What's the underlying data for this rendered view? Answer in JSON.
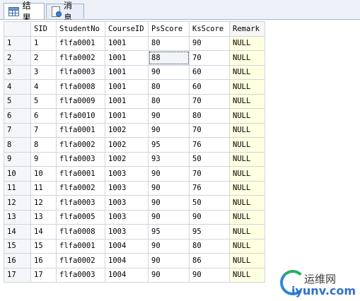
{
  "tabs": [
    {
      "label": "结果",
      "icon": "grid-icon",
      "active": true
    },
    {
      "label": "消息",
      "icon": "message-icon",
      "active": false
    }
  ],
  "columns": [
    "",
    "SID",
    "StudentNo",
    "CourseID",
    "PsScore",
    "KsScore",
    "Remark"
  ],
  "rows": [
    [
      "1",
      "1",
      "flfa0001",
      "1001",
      "80",
      "90",
      "NULL"
    ],
    [
      "2",
      "2",
      "flfa0002",
      "1001",
      "88",
      "70",
      "NULL"
    ],
    [
      "3",
      "3",
      "flfa0003",
      "1001",
      "90",
      "60",
      "NULL"
    ],
    [
      "4",
      "4",
      "flfa0008",
      "1001",
      "80",
      "60",
      "NULL"
    ],
    [
      "5",
      "5",
      "flfa0009",
      "1001",
      "80",
      "70",
      "NULL"
    ],
    [
      "6",
      "6",
      "flfa0010",
      "1001",
      "90",
      "80",
      "NULL"
    ],
    [
      "7",
      "7",
      "flfa0001",
      "1002",
      "90",
      "70",
      "NULL"
    ],
    [
      "8",
      "8",
      "flfa0002",
      "1002",
      "95",
      "76",
      "NULL"
    ],
    [
      "9",
      "9",
      "flfa0003",
      "1002",
      "93",
      "50",
      "NULL"
    ],
    [
      "10",
      "10",
      "flfa0001",
      "1003",
      "90",
      "70",
      "NULL"
    ],
    [
      "11",
      "11",
      "flfa0002",
      "1003",
      "90",
      "76",
      "NULL"
    ],
    [
      "12",
      "12",
      "flfa0003",
      "1003",
      "90",
      "50",
      "NULL"
    ],
    [
      "13",
      "13",
      "flfa0005",
      "1003",
      "90",
      "90",
      "NULL"
    ],
    [
      "14",
      "14",
      "flfa0008",
      "1003",
      "95",
      "95",
      "NULL"
    ],
    [
      "15",
      "15",
      "flfa0001",
      "1004",
      "90",
      "80",
      "NULL"
    ],
    [
      "16",
      "16",
      "flfa0002",
      "1004",
      "90",
      "86",
      "NULL"
    ],
    [
      "17",
      "17",
      "flfa0003",
      "1004",
      "90",
      "90",
      "NULL"
    ]
  ],
  "selected_cell": {
    "row": 2,
    "column": "PsScore"
  },
  "watermark": {
    "top": "运维网",
    "bottom": "iyunv.com"
  },
  "colors": {
    "null_cell": "#ffffe1",
    "tab_bar": "#eef2f8",
    "grid_line": "#d0d6de"
  }
}
